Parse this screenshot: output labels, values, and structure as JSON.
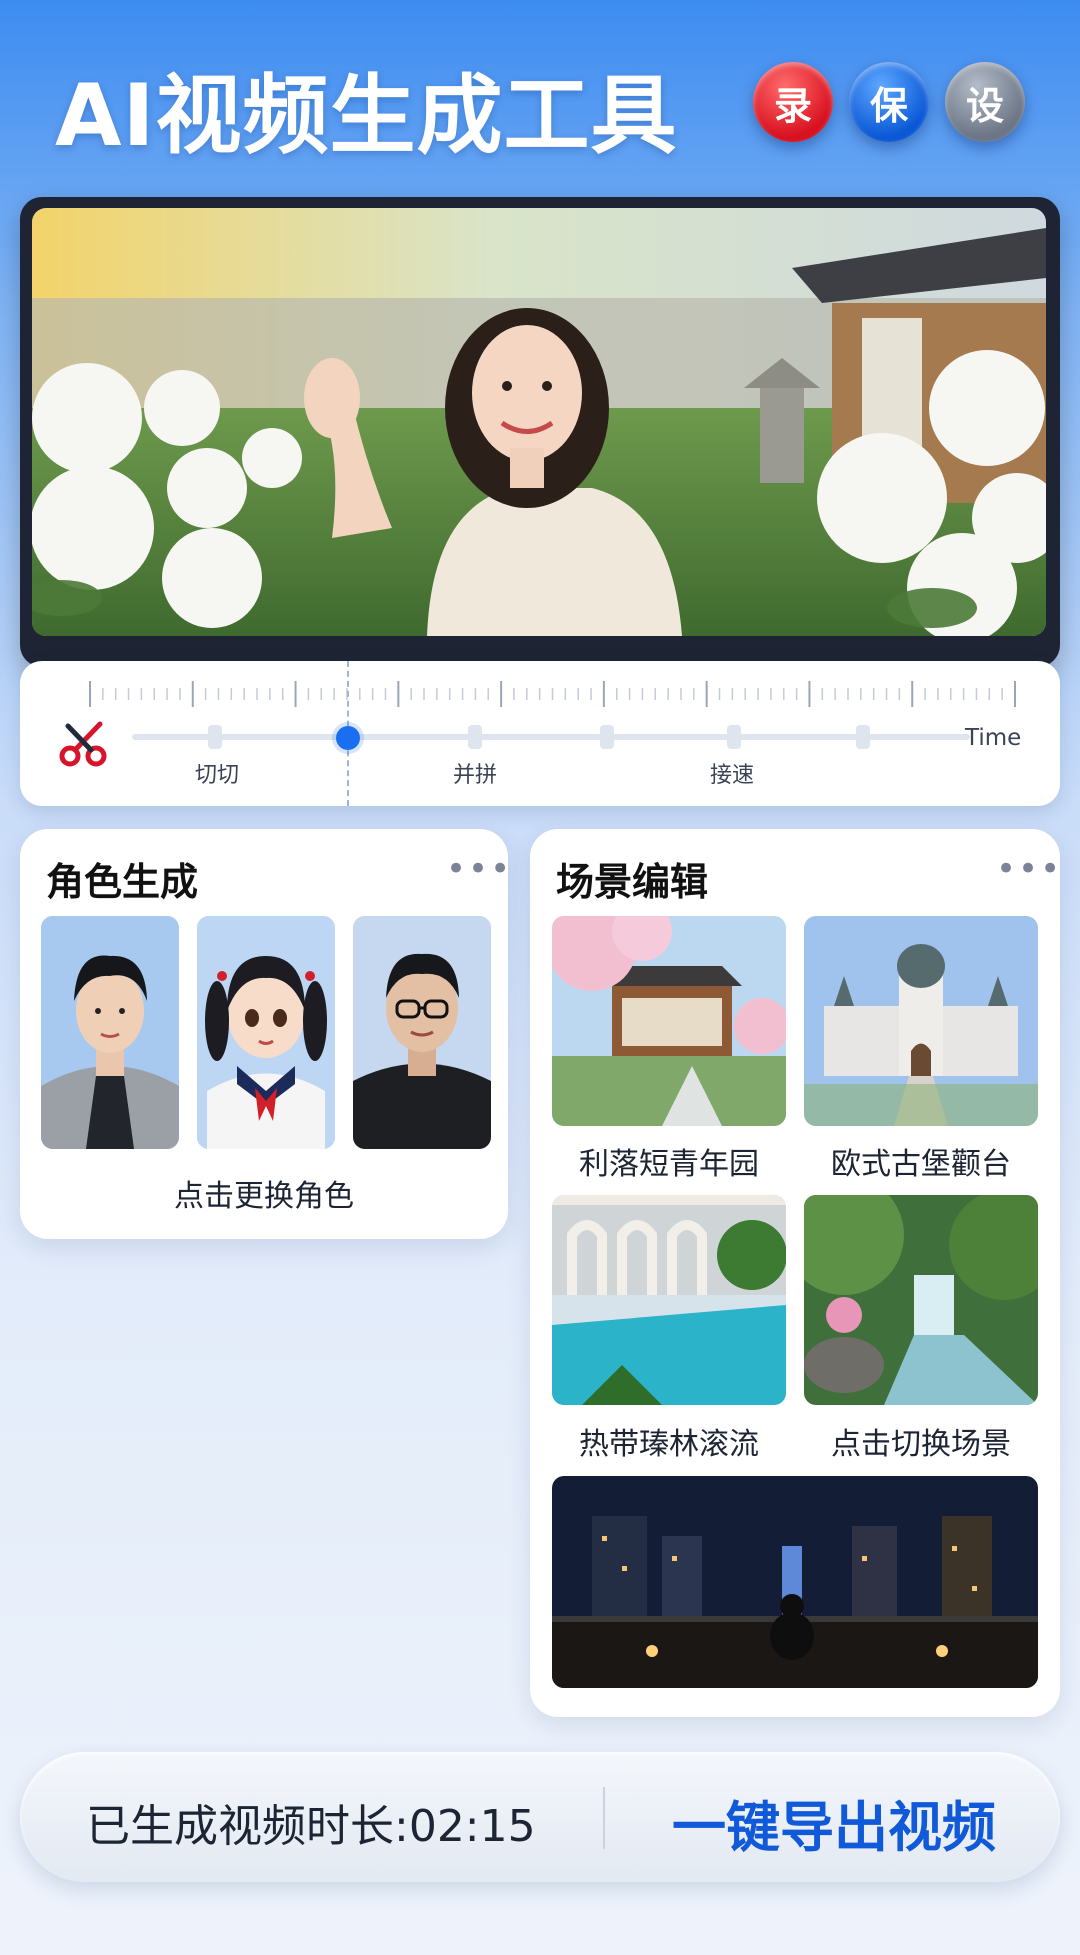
{
  "header": {
    "title": "AI视频生成工具",
    "buttons": [
      {
        "label": "录",
        "color": "#e8192c"
      },
      {
        "label": "保",
        "color": "#1567e6"
      },
      {
        "label": "设",
        "color": "#7d8796"
      }
    ]
  },
  "timeline": {
    "tools": [
      "切切",
      "并拼",
      "接速"
    ],
    "time_label": "Time"
  },
  "character_panel": {
    "title": "角色生成",
    "more_icon": "more-dots-icon",
    "change_label": "点击更换角色"
  },
  "scene_panel": {
    "title": "场景编辑",
    "more_icon": "more-dots-icon",
    "scenes": [
      {
        "label": "利落短青年园"
      },
      {
        "label": "欧式古堡颧台"
      },
      {
        "label": "热带瑧林滚流"
      },
      {
        "label": "点击切换场景"
      }
    ]
  },
  "bottom_bar": {
    "duration_label": "已生成视频时长:02:15",
    "export_label": "一键导出视频"
  }
}
